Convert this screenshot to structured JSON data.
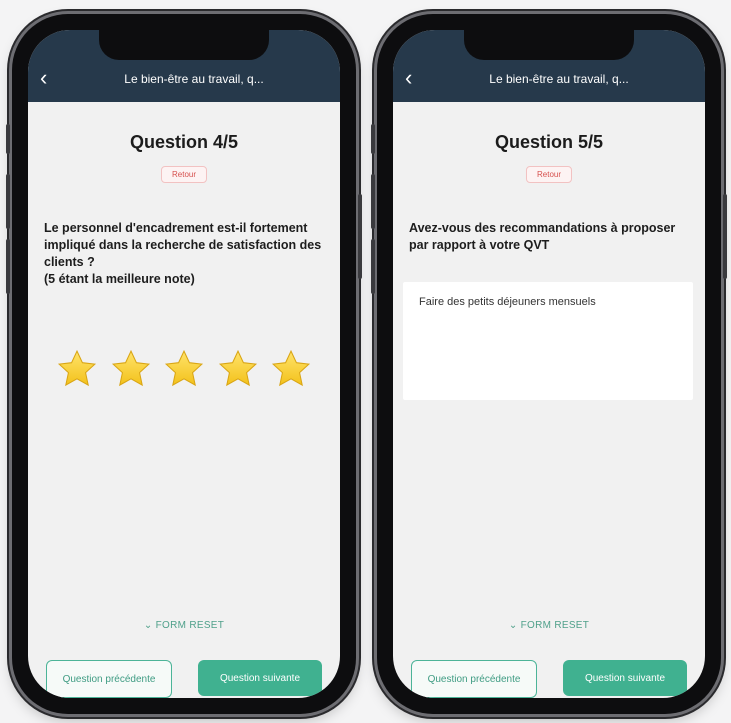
{
  "phones": [
    {
      "header": {
        "title": "Le bien-être au travail, q..."
      },
      "question": {
        "title": "Question 4/5",
        "badge": "Retour",
        "text": "Le personnel d'encadrement est-il fortement impliqué dans la recherche de satisfaction des clients ?\n(5 étant la meilleure note)"
      },
      "rating": {
        "value": 5,
        "max": 5,
        "star_color": "#f3c21b"
      },
      "reset_label": "FORM RESET",
      "buttons": {
        "previous": "Question précédente",
        "next": "Question suivante"
      }
    },
    {
      "header": {
        "title": "Le bien-être au travail, q..."
      },
      "question": {
        "title": "Question 5/5",
        "badge": "Retour",
        "text": "Avez-vous des recommandations à proposer par rapport à votre QVT"
      },
      "answer": {
        "value": "Faire des petits déjeuners mensuels"
      },
      "reset_label": "FORM RESET",
      "buttons": {
        "previous": "Question précédente",
        "next": "Question suivante"
      }
    }
  ],
  "colors": {
    "header": "#26394b",
    "accent": "#40b190",
    "badge_text": "#d6504e"
  }
}
